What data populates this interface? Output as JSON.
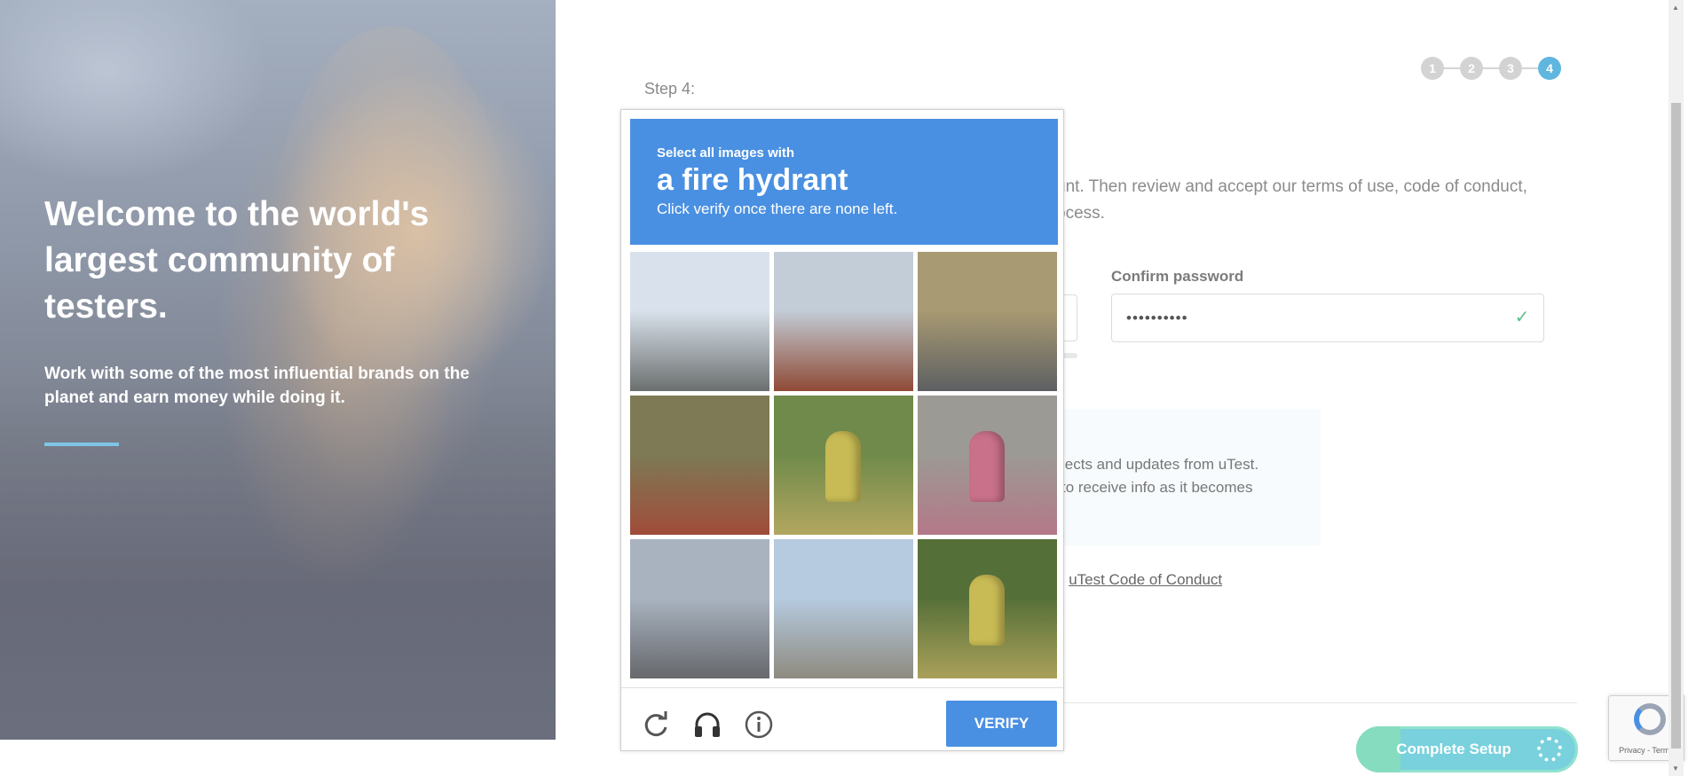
{
  "hero": {
    "title": "Welcome to the world's largest community of testers.",
    "subtitle": "Work with some of the most influential brands on the planet and earn money while doing it."
  },
  "form": {
    "step_label": "Step 4:",
    "steps": [
      "1",
      "2",
      "3",
      "4"
    ],
    "active_step": "4",
    "intro_fragment_1": "unt. Then review and accept our terms of use, code of conduct,",
    "intro_fragment_2": "ocess.",
    "confirm_password_label": "Confirm password",
    "confirm_password_value": "••••••••••",
    "optin_fragment_1": "jects and updates from uTest.",
    "optin_fragment_2": "to receive info as it becomes",
    "coc_prefix": "e ",
    "coc_link": "uTest Code of Conduct",
    "complete_button": "Complete Setup",
    "complete_progress": 0.2
  },
  "recaptcha_badge": {
    "terms": "Privacy - Terms"
  },
  "captcha": {
    "instruction_small": "Select all images with",
    "target": "a fire hydrant",
    "hint": "Click verify once there are none left.",
    "verify_label": "VERIFY",
    "footer_icons": [
      "reload-icon",
      "headphones-icon",
      "info-icon"
    ],
    "tiles": [
      {
        "name": "highway-tile",
        "colors": [
          "#d9e2ec",
          "#6b6f6e"
        ]
      },
      {
        "name": "brick-house-tile",
        "colors": [
          "#c3cdd7",
          "#8f4a35"
        ]
      },
      {
        "name": "car-guardrail-tile",
        "colors": [
          "#a89a72",
          "#5d5f62"
        ]
      },
      {
        "name": "stairs-tile",
        "colors": [
          "#7d7a55",
          "#a04c3a"
        ]
      },
      {
        "name": "yellow-hydrant-grass-tile",
        "colors": [
          "#6f8a4a",
          "#b2a760"
        ]
      },
      {
        "name": "pink-hydrant-sidewalk-tile",
        "colors": [
          "#9c9a94",
          "#b47888"
        ]
      },
      {
        "name": "street-tile",
        "colors": [
          "#a9b3c0",
          "#66686c"
        ]
      },
      {
        "name": "palm-street-tile",
        "colors": [
          "#b6cbe0",
          "#8e8a7f"
        ]
      },
      {
        "name": "yellow-hydrant-lawn-tile",
        "colors": [
          "#556f38",
          "#aaa15a"
        ]
      }
    ]
  }
}
